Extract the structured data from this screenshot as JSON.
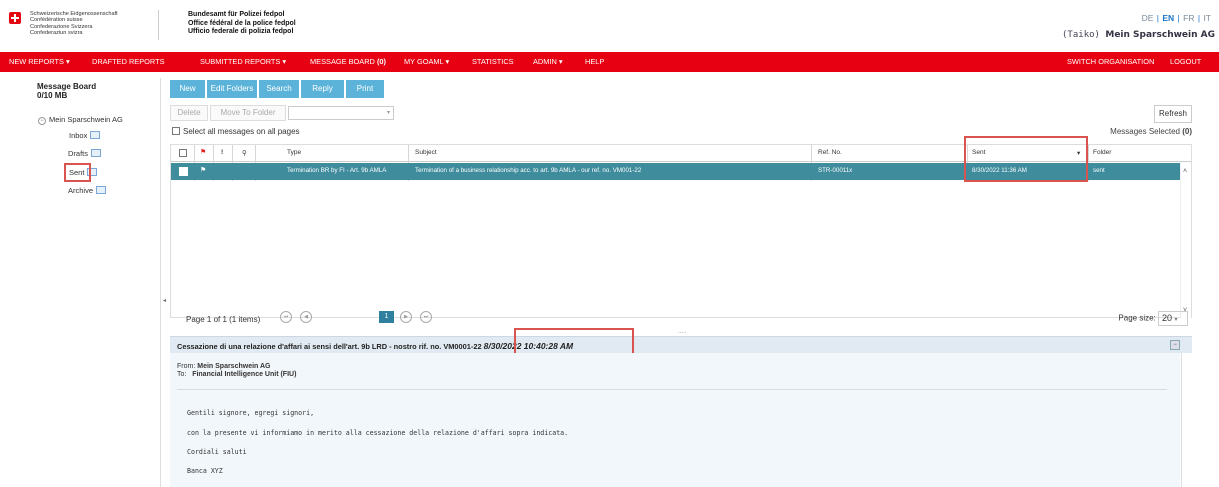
{
  "header": {
    "confederation": [
      "Schweizerische Eidgenossenschaft",
      "Confédération suisse",
      "Confederazione Svizzera",
      "Confederaziun svizra"
    ],
    "office": [
      "Bundesamt für Polizei fedpol",
      "Office fédéral de la police fedpol",
      "Ufficio federale di polizia fedpol"
    ],
    "languages": {
      "de": "DE",
      "en": "EN",
      "fr": "FR",
      "it": "IT",
      "sep": "|"
    },
    "user_prefix": "(Taiko)",
    "user_org": "Mein Sparschwein AG"
  },
  "nav": {
    "new_reports": "NEW REPORTS",
    "drafted_reports": "DRAFTED REPORTS",
    "submitted_reports": "SUBMITTED REPORTS",
    "message_board": "MESSAGE BOARD",
    "message_board_count": "(0)",
    "my_goaml": "MY GOAML",
    "statistics": "STATISTICS",
    "admin": "ADMIN",
    "help": "HELP",
    "switch_org": "SWITCH ORGANISATION",
    "logout": "LOGOUT",
    "dropdown_glyph": "▾"
  },
  "sidebar": {
    "title": "Message Board",
    "quota": "0/10 MB",
    "root": "Mein Sparschwein AG",
    "folders": {
      "inbox": "Inbox",
      "drafts": "Drafts",
      "sent": "Sent",
      "archive": "Archive"
    }
  },
  "toolbar": {
    "new": "New",
    "edit_folders": "Edit Folders",
    "search": "Search",
    "reply": "Reply",
    "print": "Print",
    "delete": "Delete",
    "move_to_folder": "Move To Folder",
    "refresh": "Refresh",
    "select_all": "Select all messages on all pages",
    "messages_selected_label": "Messages Selected",
    "messages_selected_count": "(0)"
  },
  "grid": {
    "columns": {
      "type": "Type",
      "subject": "Subject",
      "ref_no": "Ref. No.",
      "sent": "Sent",
      "folder": "Folder"
    },
    "rows": [
      {
        "type": "Termination BR by FI - Art. 9b AMLA",
        "subject": "Termination of a business relationship acc. to art. 9b AMLA - our ref. no. VM001-22",
        "ref_no": "STR-00011x",
        "sent": "8/30/2022 11:36 AM",
        "folder": "sent"
      }
    ]
  },
  "pager": {
    "info": "Page 1 of 1 (1 items)",
    "current": "1",
    "page_size_label": "Page size:",
    "page_size": "20"
  },
  "preview": {
    "subject": "Cessazione di una relazione d'affari ai sensi dell'art. 9b LRD - nostro rif. no. VM0001-22",
    "date": "8/30/2022 10:40:28 AM",
    "from_label": "From:",
    "from": "Mein Sparschwein AG",
    "to_label": "To:",
    "to": "Financial Intelligence Unit (FIU)",
    "body": [
      "Gentili signore, egregi signori,",
      "con la presente vi informiamo in merito alla cessazione della relazione d'affari sopra indicata.",
      "Cordiali saluti",
      "Banca XYZ"
    ]
  }
}
